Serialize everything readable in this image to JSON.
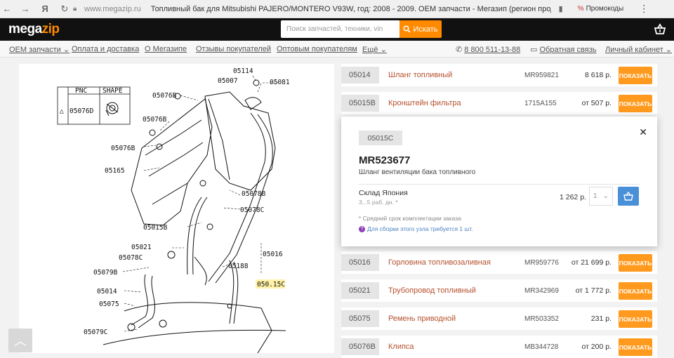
{
  "browser": {
    "url": "www.megazip.ru",
    "title": "Топливный бак для Mitsubishi PAJERO/MONTERO V93W, год: 2008 - 2009. OEM запчасти - Мегазип (регион прод…",
    "promo_label": "Промокоды"
  },
  "header": {
    "logo_mega": "mega",
    "logo_zip": "zip",
    "search_placeholder": "Поиск запчастей, техники, vin",
    "search_button": "Искать"
  },
  "nav": {
    "items": [
      "OEM запчасти",
      "Оплата и доставка",
      "О Мегазипе",
      "Отзывы покупателей",
      "Оптовым покупателям",
      "Ещё"
    ],
    "phone": "8 800 511-13-88",
    "feedback": "Обратная связь",
    "account": "Личный кабинет"
  },
  "diagram": {
    "table_headers": [
      "PNC",
      "SHAPE"
    ],
    "table_marker": "△",
    "table_pnc": "05076D",
    "labels": [
      "05114",
      "05007",
      "05081",
      "05076B",
      "05076B",
      "05076B",
      "05165",
      "05078B",
      "05078C",
      "05015B",
      "05021",
      "05016",
      "05078C",
      "05188",
      "05079B",
      "050.15C",
      "05014",
      "05075",
      "05079C"
    ]
  },
  "parts": [
    {
      "pnc": "05014",
      "name": "Шланг топливный",
      "number": "MR959821",
      "price": "8 618 р.",
      "button": "ПОКАЗАТЬ"
    },
    {
      "pnc": "05015B",
      "name": "Кронштейн фильтра",
      "number": "1715A155",
      "price": "от 507 р.",
      "button": "ПОКАЗАТЬ"
    },
    {
      "pnc": "05016",
      "name": "Горловина топливозаливная",
      "number": "MR959776",
      "price": "от 21 699 р.",
      "button": "ПОКАЗАТЬ"
    },
    {
      "pnc": "05021",
      "name": "Трубопровод топливный",
      "number": "MR342969",
      "price": "от 1 772 р.",
      "button": "ПОКАЗАТЬ"
    },
    {
      "pnc": "05075",
      "name": "Ремень приводной",
      "number": "MR503352",
      "price": "231 р.",
      "button": "ПОКАЗАТЬ"
    },
    {
      "pnc": "05076B",
      "name": "Клипса",
      "number": "MB344728",
      "price": "от 200 р.",
      "button": "ПОКАЗАТЬ"
    }
  ],
  "popup": {
    "pnc": "05015C",
    "part_number": "MR523677",
    "description": "Шланг вентиляции бака топливного",
    "warehouse": "Склад Япония",
    "delivery": "3...5 раб. дн. *",
    "price": "1 262 р.",
    "qty": "1",
    "note": "* Средний срок комплектации заказа",
    "assembly_note": "Для сборки этого узла требуется 1 шт."
  }
}
